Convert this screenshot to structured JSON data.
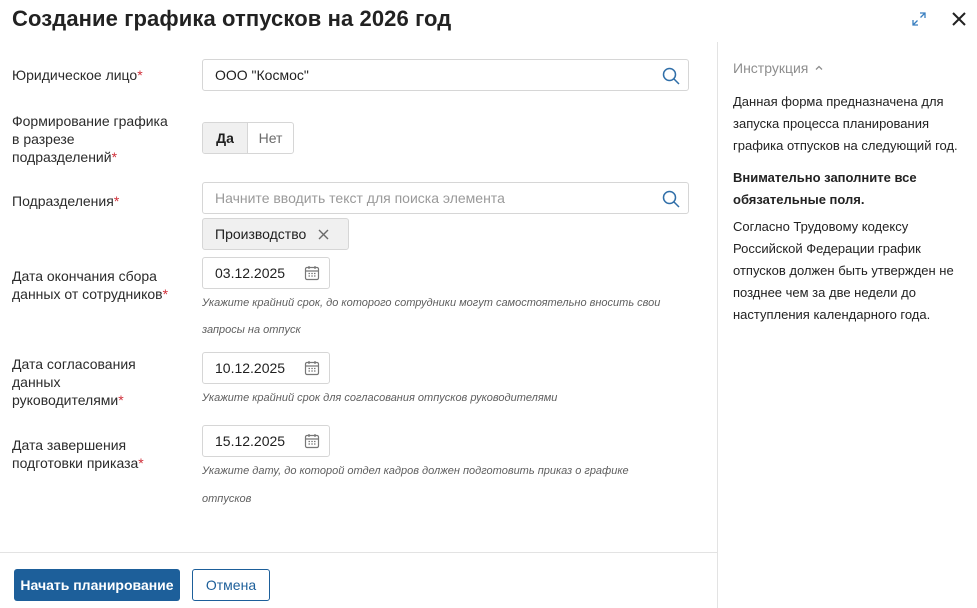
{
  "dialog": {
    "title": "Создание графика отпусков на 2026 год",
    "expand_icon": "expand-icon",
    "close_icon": "close-icon"
  },
  "form": {
    "legal_entity": {
      "label": "Юридическое лицо",
      "required": "*",
      "value": "ООО \"Космос\""
    },
    "by_department": {
      "label_line1": "Формирование графика",
      "label_line2": "в разрезе",
      "label_line3": "подразделений",
      "required": "*",
      "options": [
        "Да",
        "Нет"
      ],
      "selected": "Да"
    },
    "departments": {
      "label": "Подразделения",
      "required": "*",
      "placeholder": "Начните вводить текст для поиска элемента",
      "chips": [
        "Производство"
      ]
    },
    "collect_end": {
      "label_line1": "Дата окончания сбора",
      "label_line2": "данных от сотрудников",
      "required": "*",
      "value": "03.12.2025",
      "hint_line1": "Укажите крайний срок, до которого сотрудники могут самостоятельно вносить свои",
      "hint_line2": "запросы на отпуск"
    },
    "approval": {
      "label_line1": "Дата согласования",
      "label_line2": "данных",
      "label_line3": "руководителями",
      "required": "*",
      "value": "10.12.2025",
      "hint": "Укажите крайний срок для согласования отпусков руководителями"
    },
    "order": {
      "label_line1": "Дата завершения",
      "label_line2": "подготовки приказа",
      "required": "*",
      "value": "15.12.2025",
      "hint": "Укажите дату, до которой отдел кадров должен подготовить приказ о графике отпусков"
    }
  },
  "instruction": {
    "title": "Инструкция",
    "p1": "Данная форма предназначена для запуска процесса планирования графика отпусков на следующий год.",
    "p2": "Внимательно заполните все обязательные поля.",
    "p3": "Согласно Трудовому кодексу Российской Федерации график отпусков должен быть утвержден не позднее чем за две недели до наступления календарного года."
  },
  "footer": {
    "start_label": "Начать планирование",
    "cancel_label": "Отмена"
  },
  "colors": {
    "accent": "#1d5f9a",
    "required": "#d0303a"
  }
}
